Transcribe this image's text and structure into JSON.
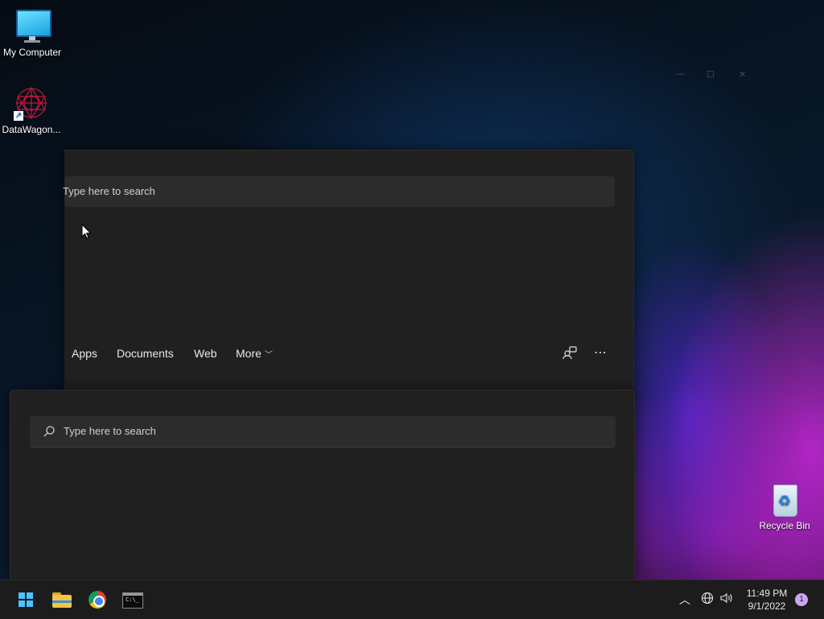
{
  "desktop": {
    "icons": [
      {
        "label": "My Computer",
        "icon": "monitor-icon"
      },
      {
        "label": "DataWagon...",
        "icon": "datawagon-app-icon"
      },
      {
        "label": "Recycle Bin",
        "icon": "recycle-bin-icon"
      }
    ]
  },
  "search_panel_back": {
    "placeholder": "Type here to search",
    "tabs": [
      "Apps",
      "Documents",
      "Web",
      "More"
    ],
    "tool_icons": [
      "share-profile-icon",
      "more-options-icon"
    ]
  },
  "search_panel_front": {
    "placeholder": "Type here to search"
  },
  "taskbar": {
    "apps": [
      "start-icon",
      "file-explorer-icon",
      "chrome-icon",
      "terminal-icon"
    ],
    "terminal_text": "C:\\_",
    "clock": {
      "time": "11:49 PM",
      "date": "9/1/2022"
    },
    "notification_count": "1"
  },
  "colors": {
    "accent": "#4cc2ff",
    "panel_bg": "#202020",
    "search_bg": "#2c2c2c",
    "taskbar_bg": "#1c1c1c"
  }
}
